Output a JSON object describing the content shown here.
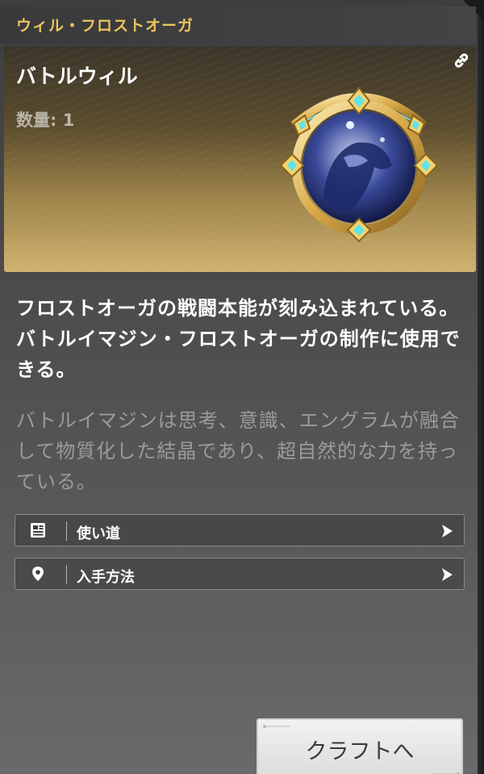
{
  "header": {
    "title": "ウィル・フロストオーガ"
  },
  "item": {
    "name": "バトルウィル",
    "quantity": "数量: 1",
    "link_icon": "link-icon",
    "image": "battle-will-emblem"
  },
  "description": {
    "main": "フロストオーガの戦闘本能が刻み込まれている。バトルイマジン・フロストオーガの制作に使用できる。",
    "flavor": "バトルイマジンは思考、意識、エングラムが融合して物質化した結晶であり、超自然的な力を持っている。"
  },
  "actions": [
    {
      "label": "使い道",
      "icon": "document-icon"
    },
    {
      "label": "入手方法",
      "icon": "location-pin-icon"
    }
  ],
  "craft_button": {
    "label": "クラフトへ"
  },
  "colors": {
    "accent_gold": "#e9c55b",
    "text_white": "#ffffff",
    "text_muted": "#9b9b9d"
  }
}
